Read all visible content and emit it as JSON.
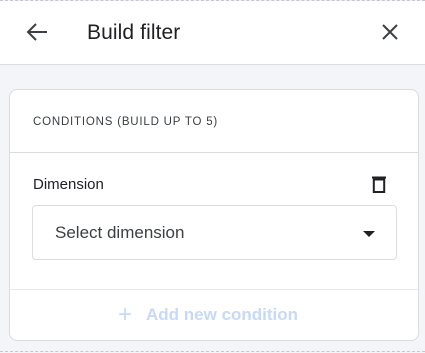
{
  "header": {
    "title": "Build filter",
    "back_icon": "arrow-left-icon",
    "close_icon": "close-icon"
  },
  "conditions": {
    "heading": "CONDITIONS (BUILD UP TO 5)",
    "dimension_label": "Dimension",
    "delete_icon": "trash-icon",
    "select_placeholder": "Select dimension",
    "add_plus": "+",
    "add_label": "Add new condition"
  },
  "colors": {
    "page_background": "#f3f5f9",
    "card_border": "#dadce0",
    "add_link_disabled": "#c6daf7"
  }
}
